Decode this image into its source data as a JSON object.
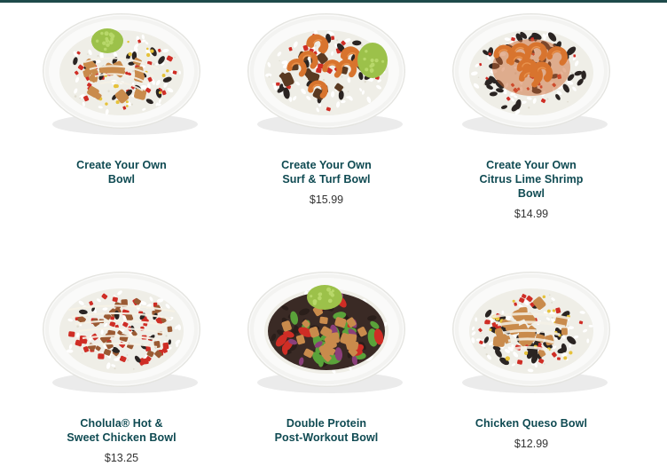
{
  "colors": {
    "title": "#0f4a52",
    "price": "#333333",
    "plate": "#f3f3f1",
    "plate_rim": "#e4e4e0",
    "rice": "#efeee7",
    "guac": "#9cc14a",
    "shrimp": "#d8742e",
    "chicken": "#c98b4c",
    "sauce": "#ce6a34",
    "tomato": "#cf2d25",
    "bean": "#2a2422",
    "corn": "#e6c23a",
    "pepper_green": "#5aa23a",
    "crema": "#f5f1e6"
  },
  "menu": {
    "items": [
      {
        "title_line1": "Create Your Own",
        "title_line2": "Bowl",
        "title_line3": "",
        "price": "",
        "image_icon": "bowl-with-chicken-and-guacamole-photo"
      },
      {
        "title_line1": "Create Your Own",
        "title_line2": "Surf & Turf Bowl",
        "title_line3": "",
        "price": "$15.99",
        "image_icon": "bowl-with-shrimp-and-steak-photo"
      },
      {
        "title_line1": "Create Your Own",
        "title_line2": "Citrus Lime Shrimp",
        "title_line3": "Bowl",
        "price": "$14.99",
        "image_icon": "bowl-with-shrimp-photo"
      },
      {
        "title_line1": "Cholula® Hot &",
        "title_line2": "Sweet Chicken Bowl",
        "title_line3": "",
        "price": "$13.25",
        "image_icon": "bowl-with-hot-chicken-photo"
      },
      {
        "title_line1": "Double Protein",
        "title_line2": "Post-Workout Bowl",
        "title_line3": "",
        "price": "",
        "image_icon": "bowl-with-double-protein-photo"
      },
      {
        "title_line1": "Chicken Queso Bowl",
        "title_line2": "",
        "title_line3": "",
        "price": "$12.99",
        "image_icon": "bowl-with-chicken-queso-photo"
      }
    ]
  }
}
